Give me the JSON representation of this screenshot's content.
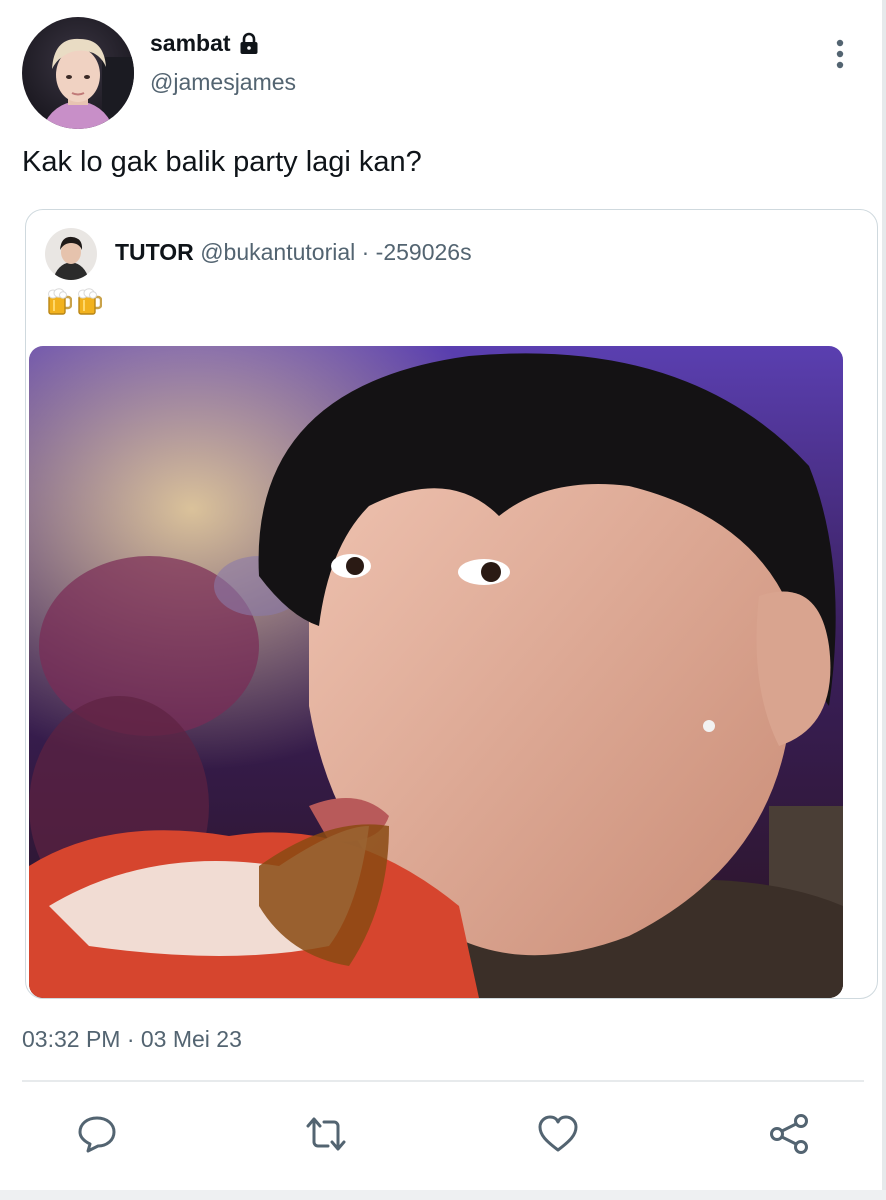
{
  "author": {
    "display_name": "sambat",
    "handle": "@jamesjames"
  },
  "tweet": {
    "text": "Kak lo gak balik party lagi kan?",
    "timestamp": "03:32 PM · 03 Mei 23"
  },
  "quote": {
    "name": "TUTOR",
    "meta": "@bukantutorial · -259026s",
    "emoji": [
      "beer-mug",
      "beer-mug"
    ]
  },
  "colors": {
    "text_primary": "#0f1419",
    "text_secondary": "#536471",
    "border": "#cfd9de",
    "icon": "#536471"
  },
  "icons": {
    "lock": "lock-icon",
    "more": "more-vertical-icon",
    "reply": "reply-icon",
    "retweet": "retweet-icon",
    "like": "heart-icon",
    "share": "share-icon"
  }
}
